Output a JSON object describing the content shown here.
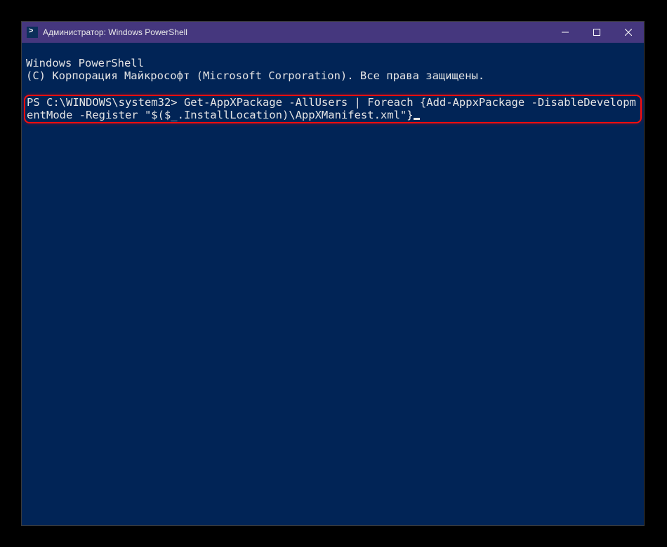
{
  "window": {
    "title": "Администратор: Windows PowerShell"
  },
  "console": {
    "header_line1": "Windows PowerShell",
    "header_line2": "(C) Корпорация Майкрософт (Microsoft Corporation). Все права защищены.",
    "prompt": "PS C:\\WINDOWS\\system32> ",
    "command": "Get-AppXPackage -AllUsers | Foreach {Add-AppxPackage -DisableDevelopmentMode -Register \"$($_.InstallLocation)\\AppXManifest.xml\"}"
  },
  "icons": {
    "app": "powershell-icon",
    "min": "minimize-icon",
    "max": "maximize-icon",
    "close": "close-icon"
  }
}
